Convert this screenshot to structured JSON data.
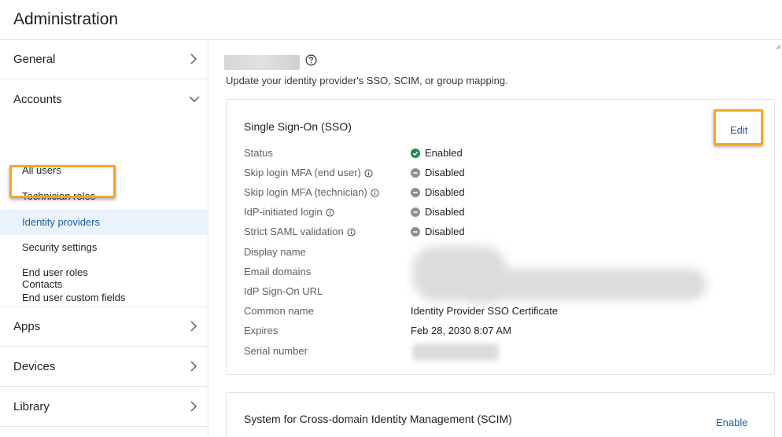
{
  "header": {
    "title": "Administration"
  },
  "sidebar": {
    "sections": [
      {
        "label": "General"
      },
      {
        "label": "Accounts"
      },
      {
        "label": "Apps"
      },
      {
        "label": "Devices"
      },
      {
        "label": "Library"
      }
    ],
    "accounts_items": [
      {
        "label": "All users"
      },
      {
        "label": "Technician roles"
      },
      {
        "label": "Identity providers"
      },
      {
        "label": "Security settings"
      },
      {
        "label": "End user roles"
      },
      {
        "label": "End user custom fields"
      },
      {
        "label": "Contacts"
      }
    ],
    "active_item": "Identity providers"
  },
  "main": {
    "subtitle": "Update your identity provider's SSO, SCIM, or group mapping.",
    "sso": {
      "title": "Single Sign-On (SSO)",
      "edit_label": "Edit",
      "rows": [
        {
          "key": "Status",
          "value": "Enabled",
          "status": "enabled"
        },
        {
          "key": "Skip login MFA (end user)",
          "value": "Disabled",
          "status": "disabled",
          "info": true
        },
        {
          "key": "Skip login MFA (technician)",
          "value": "Disabled",
          "status": "disabled",
          "info": true
        },
        {
          "key": "IdP-initiated login",
          "value": "Disabled",
          "status": "disabled",
          "info": true
        },
        {
          "key": "Strict SAML validation",
          "value": "Disabled",
          "status": "disabled",
          "info": true
        },
        {
          "key": "Display name",
          "value": ""
        },
        {
          "key": "Email domains",
          "value": ""
        },
        {
          "key": "IdP Sign-On URL",
          "value": ""
        },
        {
          "key": "Common name",
          "value": "Identity Provider SSO Certificate"
        },
        {
          "key": "Expires",
          "value": "Feb 28, 2030 8:07 AM"
        },
        {
          "key": "Serial number",
          "value": ""
        }
      ]
    },
    "scim": {
      "title": "System for Cross-domain Identity Management (SCIM)",
      "enable_label": "Enable"
    }
  },
  "colors": {
    "accent": "#1b5fa6",
    "highlight": "#f5a623",
    "enabled": "#1e8a4f",
    "disabled": "#8a9099",
    "active_bg": "#eaf2fb"
  },
  "icons": {
    "help": "help-circle-icon",
    "info": "info-icon",
    "chevron_right": "chevron-right-icon",
    "chevron_down": "chevron-down-icon",
    "check": "check-circle-icon",
    "minus": "minus-circle-icon"
  }
}
